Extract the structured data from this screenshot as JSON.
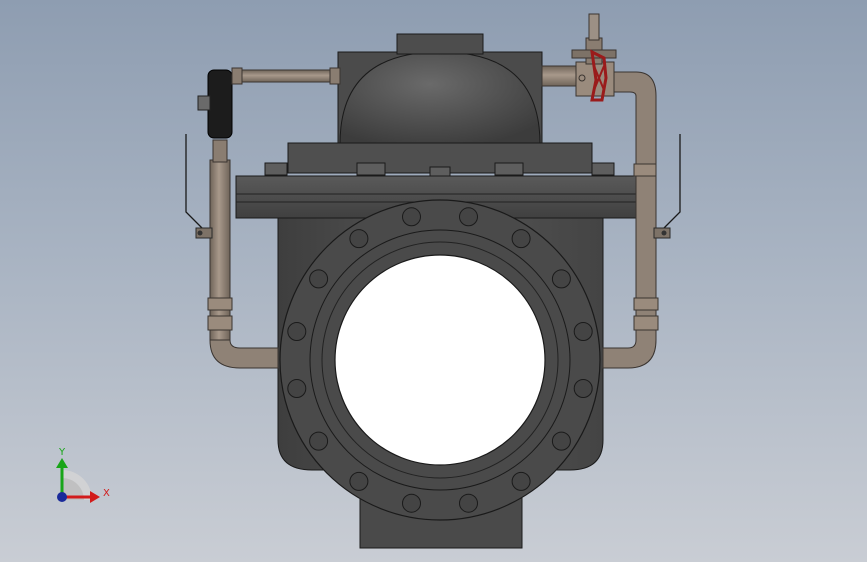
{
  "scene": {
    "colors": {
      "body": "#4e4e4e",
      "body_light": "#626262",
      "body_dark": "#3a3a3a",
      "pipe": "#8f8276",
      "pipe_light": "#a8998b",
      "pipe_dark": "#6f6459",
      "red_wheel": "#9a1b1b",
      "gauge": "#1c1c1c",
      "outline": "#1a1a1a"
    }
  },
  "triad": {
    "y_label": "Y",
    "x_label": "X",
    "y_color": "#19a519",
    "x_color": "#d21b1b",
    "origin_color": "#1a2a9a"
  }
}
